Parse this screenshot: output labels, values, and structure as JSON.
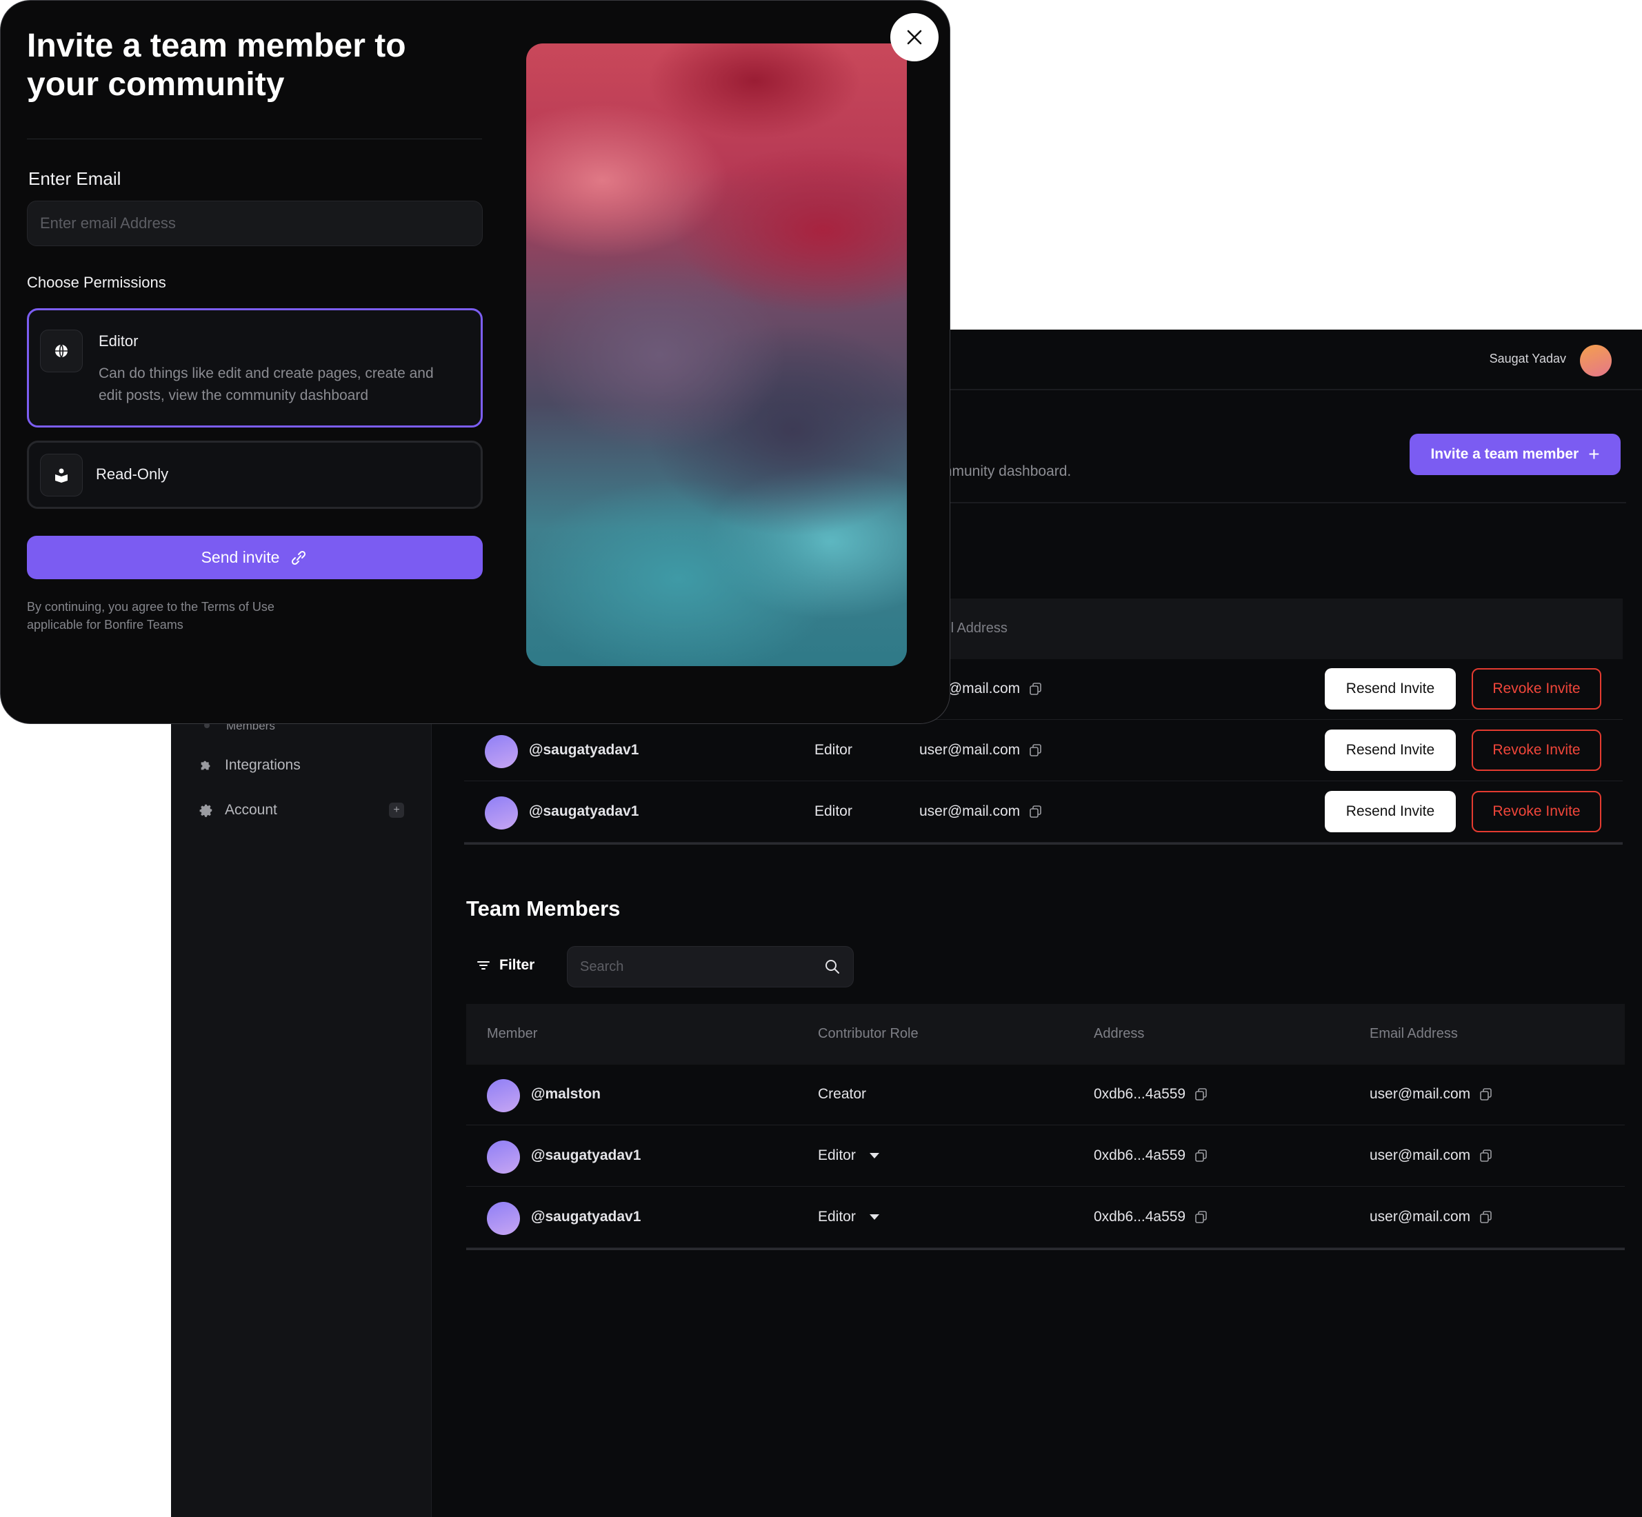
{
  "header": {
    "user_name": "Saugat Yadav"
  },
  "page": {
    "subtitle_fragment": "mmunity dashboard.",
    "invite_button_label": "Invite a team member"
  },
  "sidebar": {
    "sub_item": "Members",
    "items": [
      {
        "label": "Integrations",
        "icon": "puzzle-icon"
      },
      {
        "label": "Account",
        "icon": "gear-icon"
      }
    ],
    "account_add": "+"
  },
  "pending_invites": {
    "column_email": "Email Address",
    "rows": [
      {
        "handle": "",
        "role": "",
        "email": "user@mail.com"
      },
      {
        "handle": "@saugatyadav1",
        "role": "Editor",
        "email": "user@mail.com"
      },
      {
        "handle": "@saugatyadav1",
        "role": "Editor",
        "email": "user@mail.com"
      }
    ],
    "resend_label": "Resend Invite",
    "revoke_label": "Revoke Invite"
  },
  "team_members": {
    "title": "Team Members",
    "filter_label": "Filter",
    "search_placeholder": "Search",
    "columns": [
      "Member",
      "Contributor Role",
      "Address",
      "Email Address"
    ],
    "rows": [
      {
        "handle": "@malston",
        "role": "Creator",
        "address": "0xdb6...4a559",
        "email": "user@mail.com"
      },
      {
        "handle": "@saugatyadav1",
        "role": "Editor",
        "address": "0xdb6...4a559",
        "email": "user@mail.com"
      },
      {
        "handle": "@saugatyadav1",
        "role": "Editor",
        "address": "0xdb6...4a559",
        "email": "user@mail.com"
      }
    ]
  },
  "modal": {
    "title": "Invite a team member to your community",
    "email_label": "Enter Email",
    "email_placeholder": "Enter email Address",
    "permissions_label": "Choose Permissions",
    "editor": {
      "name": "Editor",
      "description": "Can do things like edit and create pages, create and edit posts, view the community dashboard"
    },
    "read_only": {
      "name": "Read-Only"
    },
    "send_label": "Send invite",
    "terms": "By continuing, you agree to the Terms of Use applicable for Bonfire Teams"
  },
  "colors": {
    "accent": "#7b5cf2",
    "danger": "#f0463a",
    "background": "#0a0b0d"
  }
}
